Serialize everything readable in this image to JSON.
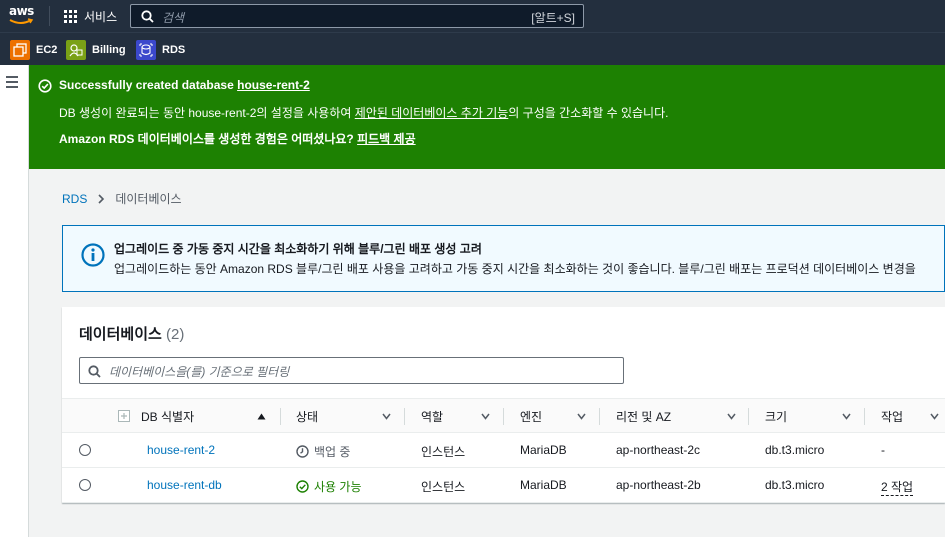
{
  "topnav": {
    "logo_text": "aws",
    "services_label": "서비스",
    "search_placeholder": "검색",
    "search_shortcut": "[알트+S]"
  },
  "favorites": [
    {
      "label": "EC2",
      "icon": "ec2-icon",
      "color": "#ed7100"
    },
    {
      "label": "Billing",
      "icon": "billing-icon",
      "color": "#7aa116"
    },
    {
      "label": "RDS",
      "icon": "rds-icon",
      "color": "#3b48cc"
    }
  ],
  "flash": {
    "title_prefix": "Successfully created database",
    "db_name": "house-rent-2",
    "line2_prefix": "DB 생성이 완료되는 동안 house-rent-2의 설정을 사용하여",
    "line2_link": "제안된 데이터베이스 추가 기능",
    "line2_suffix": "의 구성을 간소화할 수 있습니다.",
    "line3_prefix": "Amazon RDS 데이터베이스를 생성한 경험은 어떠셨나요?",
    "line3_link": "피드백 제공",
    "color": "#1d8102"
  },
  "breadcrumb": {
    "root": "RDS",
    "current": "데이터베이스"
  },
  "info": {
    "title": "업그레이드 중 가동 중지 시간을 최소화하기 위해 블루/그린 배포 생성 고려",
    "body": "업그레이드하는 동안 Amazon RDS 블루/그린 배포 사용을 고려하고 가동 중지 시간을 최소화하는 것이 좋습니다. 블루/그린 배포는 프로덕션 데이터베이스 변경을"
  },
  "databases": {
    "title": "데이터베이스",
    "count": "(2)",
    "filter_placeholder": "데이터베이스을(를) 기준으로 필터링",
    "columns": {
      "id": "DB 식별자",
      "status": "상태",
      "role": "역할",
      "engine": "엔진",
      "region": "리전 및 AZ",
      "size": "크기",
      "actions": "작업"
    },
    "rows": [
      {
        "id": "house-rent-2",
        "status": "백업 중",
        "status_type": "pending",
        "role": "인스턴스",
        "engine": "MariaDB",
        "region": "ap-northeast-2c",
        "size": "db.t3.micro",
        "actions": "-"
      },
      {
        "id": "house-rent-db",
        "status": "사용 가능",
        "status_type": "available",
        "role": "인스턴스",
        "engine": "MariaDB",
        "region": "ap-northeast-2b",
        "size": "db.t3.micro",
        "actions": "2 작업"
      }
    ]
  }
}
